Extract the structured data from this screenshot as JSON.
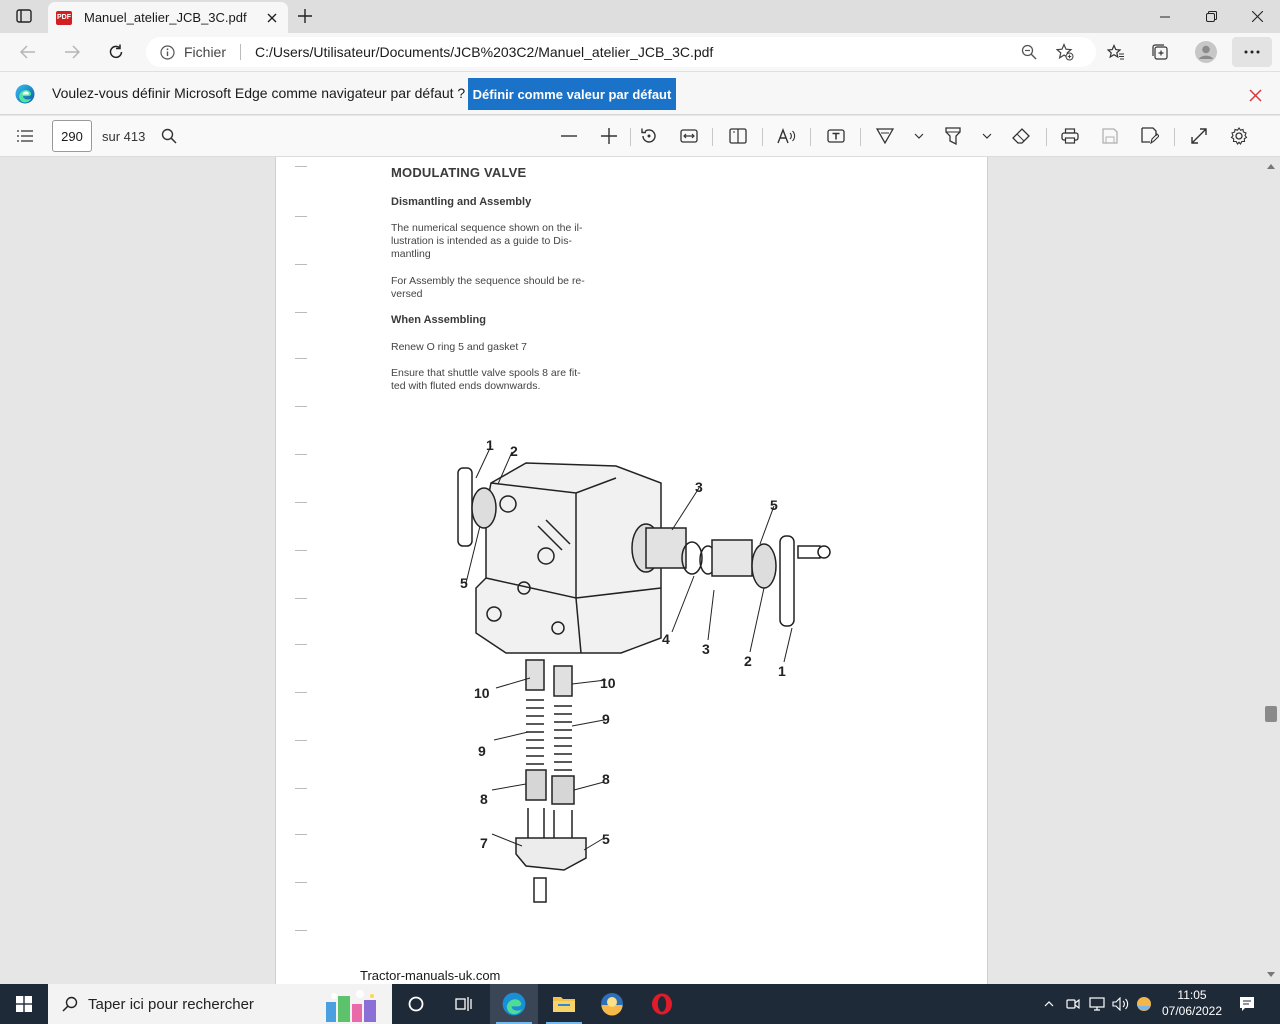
{
  "tab": {
    "title": "Manuel_atelier_JCB_3C.pdf",
    "badge": "PDF"
  },
  "address": {
    "scheme_label": "Fichier",
    "url": "C:/Users/Utilisateur/Documents/JCB%203C2/Manuel_atelier_JCB_3C.pdf"
  },
  "infobar": {
    "message": "Voulez-vous définir Microsoft Edge comme navigateur par défaut ?",
    "button": "Définir comme valeur par défaut"
  },
  "pdf_toolbar": {
    "page": "290",
    "total": "sur 413"
  },
  "document": {
    "heading": "MODULATING VALVE",
    "sub1": "Dismantling and Assembly",
    "para1": "The numerical sequence shown on the il- lustration is intended as a guide to Dis- mantling",
    "para2": "For Assembly the sequence should be re- versed",
    "sub2": "When Assembling",
    "para3": "Renew O ring 5 and gasket 7",
    "para4": "Ensure that shuttle valve spools 8 are fit- ted with fluted ends downwards.",
    "footer": "Tractor-manuals-uk.com",
    "callouts": [
      "1",
      "2",
      "5",
      "3",
      "5",
      "4",
      "3",
      "2",
      "1",
      "10",
      "10",
      "9",
      "9",
      "8",
      "8",
      "7",
      "5"
    ]
  },
  "taskbar": {
    "search_placeholder": "Taper ici pour rechercher",
    "time": "11:05",
    "date": "07/06/2022"
  },
  "colors": {
    "accent": "#1a73c9",
    "taskbar": "#1f2a38",
    "pdf_badge": "#d11f22"
  },
  "icons": [
    "tab-actions-icon",
    "pdf-icon",
    "close-icon",
    "plus-icon",
    "minimize-icon",
    "restore-icon",
    "back-icon",
    "forward-icon",
    "refresh-icon",
    "info-icon",
    "zoom-icon",
    "add-favorite-icon",
    "favorites-icon",
    "collections-icon",
    "profile-icon",
    "more-icon",
    "edge-icon",
    "contents-icon",
    "search-icon",
    "zoom-out-icon",
    "zoom-in-icon",
    "rotate-icon",
    "fit-page-icon",
    "page-view-icon",
    "read-aloud-icon",
    "text-icon",
    "draw-icon",
    "highlight-icon",
    "eraser-icon",
    "print-icon",
    "save-icon",
    "save-as-icon",
    "fullscreen-icon",
    "settings-icon",
    "windows-icon",
    "cortana-icon",
    "task-view-icon",
    "file-explorer-icon",
    "opera-icon",
    "notification-icon"
  ]
}
